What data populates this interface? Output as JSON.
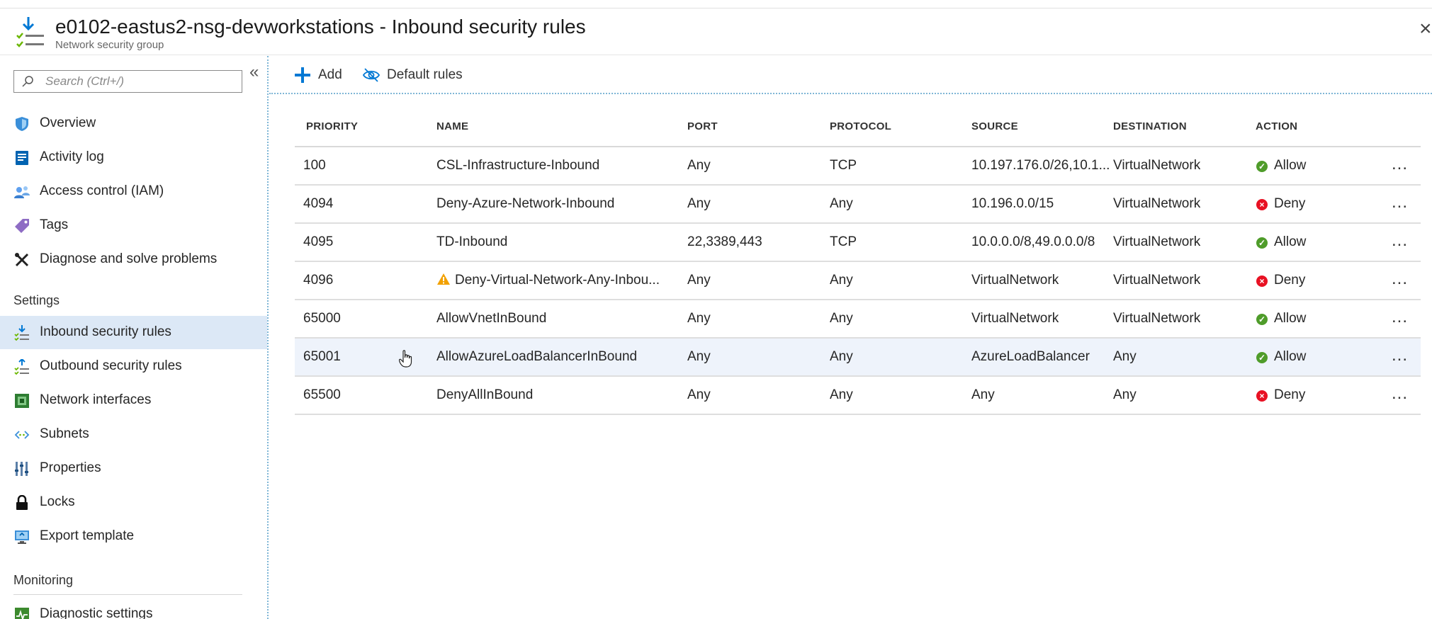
{
  "header": {
    "title": "e0102-eastus2-nsg-devworkstations - Inbound security rules",
    "subtitle": "Network security group"
  },
  "sidebar": {
    "search_placeholder": "Search (Ctrl+/)",
    "items": [
      {
        "label": "Overview",
        "icon": "shield-icon"
      },
      {
        "label": "Activity log",
        "icon": "activity-log-icon"
      },
      {
        "label": "Access control (IAM)",
        "icon": "people-icon"
      },
      {
        "label": "Tags",
        "icon": "tag-icon"
      },
      {
        "label": "Diagnose and solve problems",
        "icon": "wrench-icon"
      }
    ],
    "settings_header": "Settings",
    "settings_items": [
      {
        "label": "Inbound security rules",
        "icon": "inbound-rules-icon",
        "active": true
      },
      {
        "label": "Outbound security rules",
        "icon": "outbound-rules-icon"
      },
      {
        "label": "Network interfaces",
        "icon": "network-interface-icon"
      },
      {
        "label": "Subnets",
        "icon": "subnet-icon"
      },
      {
        "label": "Properties",
        "icon": "properties-icon"
      },
      {
        "label": "Locks",
        "icon": "lock-icon"
      },
      {
        "label": "Export template",
        "icon": "export-template-icon"
      }
    ],
    "monitoring_header": "Monitoring",
    "monitoring_items": [
      {
        "label": "Diagnostic settings",
        "icon": "diagnostic-settings-icon"
      }
    ]
  },
  "toolbar": {
    "add_label": "Add",
    "default_rules_label": "Default rules"
  },
  "table": {
    "columns": [
      "PRIORITY",
      "NAME",
      "PORT",
      "PROTOCOL",
      "SOURCE",
      "DESTINATION",
      "ACTION"
    ],
    "rows": [
      {
        "priority": "100",
        "name": "CSL-Infrastructure-Inbound",
        "port": "Any",
        "protocol": "TCP",
        "source": "10.197.176.0/26,10.1...",
        "destination": "VirtualNetwork",
        "action": "Allow"
      },
      {
        "priority": "4094",
        "name": "Deny-Azure-Network-Inbound",
        "port": "Any",
        "protocol": "Any",
        "source": "10.196.0.0/15",
        "destination": "VirtualNetwork",
        "action": "Deny"
      },
      {
        "priority": "4095",
        "name": "TD-Inbound",
        "port": "22,3389,443",
        "protocol": "TCP",
        "source": "10.0.0.0/8,49.0.0.0/8",
        "destination": "VirtualNetwork",
        "action": "Allow"
      },
      {
        "priority": "4096",
        "name": "Deny-Virtual-Network-Any-Inbou...",
        "warning": true,
        "port": "Any",
        "protocol": "Any",
        "source": "VirtualNetwork",
        "destination": "VirtualNetwork",
        "action": "Deny"
      },
      {
        "priority": "65000",
        "name": "AllowVnetInBound",
        "port": "Any",
        "protocol": "Any",
        "source": "VirtualNetwork",
        "destination": "VirtualNetwork",
        "action": "Allow"
      },
      {
        "priority": "65001",
        "name": "AllowAzureLoadBalancerInBound",
        "port": "Any",
        "protocol": "Any",
        "source": "AzureLoadBalancer",
        "destination": "Any",
        "action": "Allow",
        "highlighted": true
      },
      {
        "priority": "65500",
        "name": "DenyAllInBound",
        "port": "Any",
        "protocol": "Any",
        "source": "Any",
        "destination": "Any",
        "action": "Deny"
      }
    ],
    "more_label": "..."
  },
  "colors": {
    "accent": "#0078d4",
    "allow": "#4f9c2a",
    "deny": "#e81123",
    "warning": "#f2a100",
    "active_nav": "#dce8f6",
    "row_highlight": "#eef3fb"
  }
}
